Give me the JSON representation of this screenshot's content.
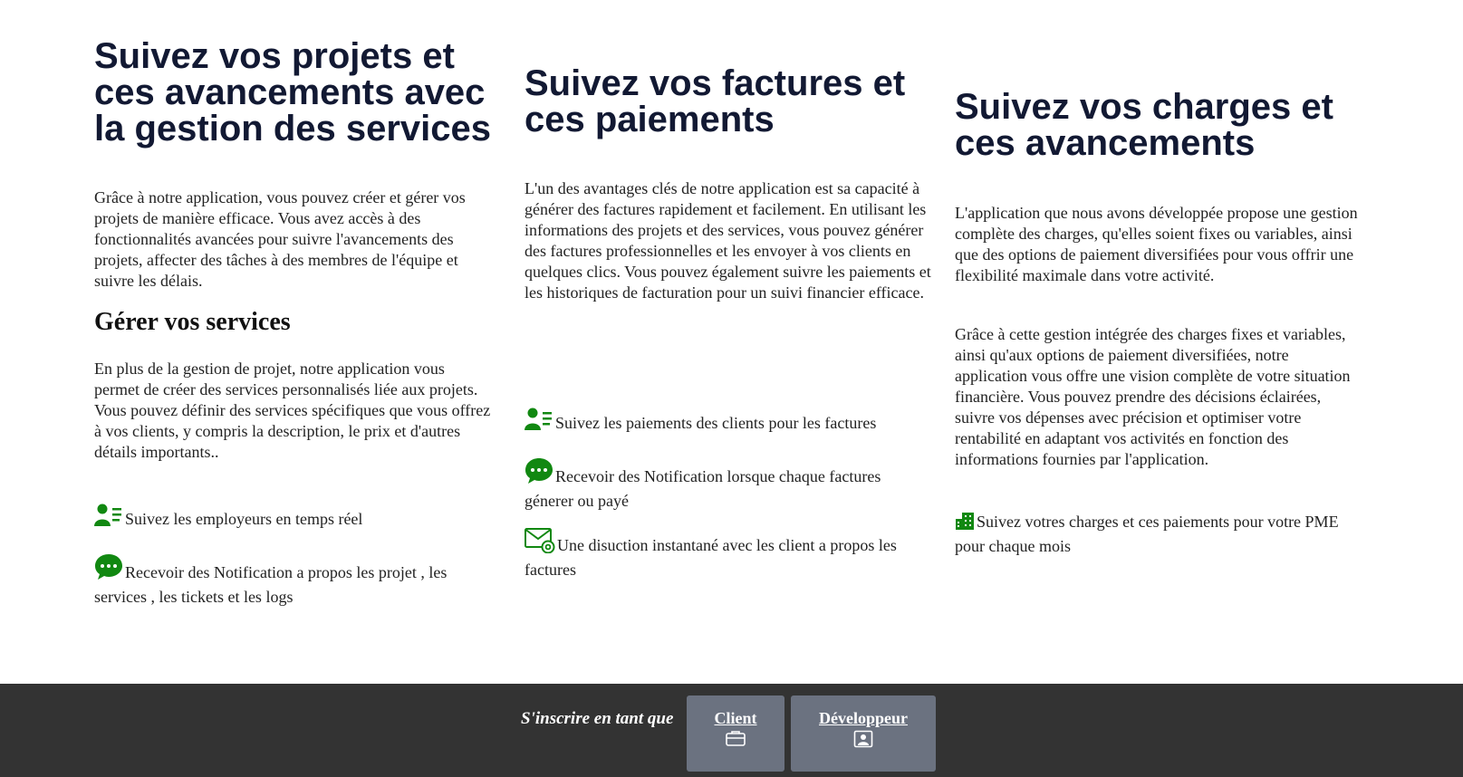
{
  "columns": [
    {
      "heading": "Suivez vos projets et ces avancements avec la gestion des services",
      "paragraph": "Grâce à notre application, vous pouvez créer et gérer vos projets de manière efficace. Vous avez accès à des fonctionnalités avancées pour suivre l'avancements des projets, affecter des tâches à des membres de l'équipe et suivre les délais.",
      "subheading": "Gérer vos services",
      "paragraph2": "En plus de la gestion de projet, notre application vous permet de créer des services personnalisés liée aux projets. Vous pouvez définir des services spécifiques que vous offrez à vos clients, y compris la description, le prix et d'autres détails importants..",
      "features": [
        {
          "icon": "user-list-icon",
          "text": "Suivez les employeurs en temps réel"
        },
        {
          "icon": "chat-bubble-icon",
          "text": "Recevoir des Notification a propos les projet , les services , les tickets et les logs"
        }
      ]
    },
    {
      "heading": "Suivez vos factures et ces paiements",
      "paragraph": "L'un des avantages clés de notre application est sa capacité à générer des factures rapidement et facilement. En utilisant les informations des projets et des services, vous pouvez générer des factures professionnelles et les envoyer à vos clients en quelques clics. Vous pouvez également suivre les paiements et les historiques de facturation pour un suivi financier efficace.",
      "features": [
        {
          "icon": "user-list-icon",
          "text": "Suivez les paiements des clients pour les factures"
        },
        {
          "icon": "chat-bubble-icon",
          "text": "Recevoir des Notification lorsque chaque factures génerer ou payé"
        },
        {
          "icon": "envelope-at-icon",
          "text": "Une disuction instantané avec les client a propos les factures"
        }
      ]
    },
    {
      "heading": "Suivez vos charges et ces avancements",
      "paragraph": "L'application que nous avons développée propose une gestion complète des charges, qu'elles soient fixes ou variables, ainsi que des options de paiement diversifiées pour vous offrir une flexibilité maximale dans votre activité.",
      "paragraph2": "Grâce à cette gestion intégrée des charges fixes et variables, ainsi qu'aux options de paiement diversifiées, notre application vous offre une vision complète de votre situation financière. Vous pouvez prendre des décisions éclairées, suivre vos dépenses avec précision et optimiser votre rentabilité en adaptant vos activités en fonction des informations fournies par l'application.",
      "features": [
        {
          "icon": "buildings-icon",
          "text": "Suivez votres charges et ces paiements pour votre PME pour chaque mois"
        }
      ]
    }
  ],
  "footer": {
    "signup_label": "S'inscrire en tant que",
    "client_label": "Client",
    "client_icon": "briefcase-icon",
    "developer_label": "Développeur",
    "developer_icon": "person-badge-icon"
  },
  "colors": {
    "heading": "#121933",
    "icon_green": "#118811",
    "footer_bg": "#333333",
    "button_bg": "#6b7280"
  }
}
